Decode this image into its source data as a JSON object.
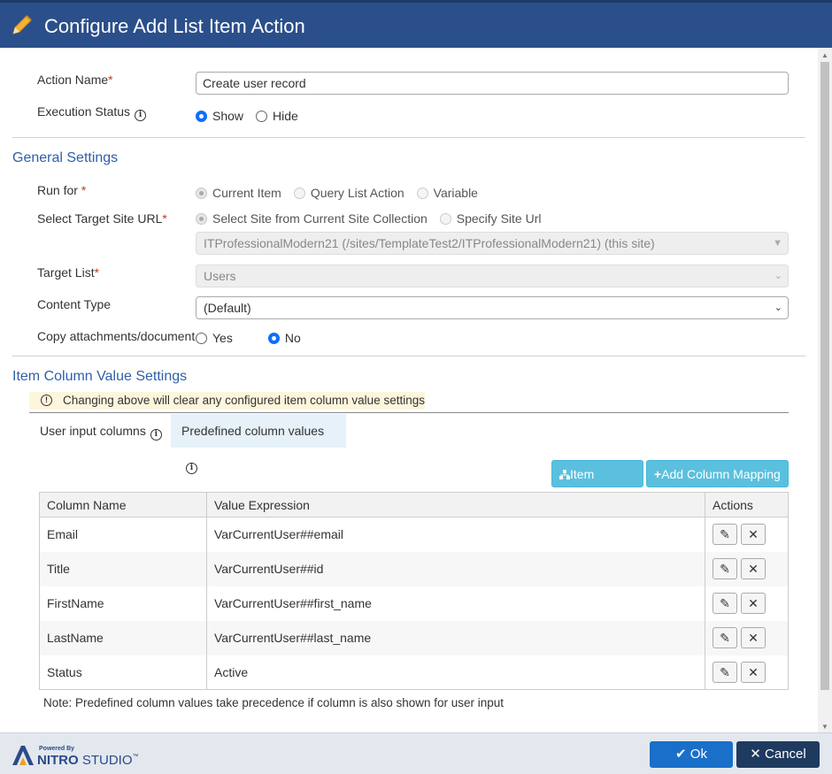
{
  "dialog": {
    "title": "Configure Add List Item Action"
  },
  "form": {
    "action_name": {
      "label": "Action Name",
      "required_mark": "*",
      "value": "Create user record"
    },
    "execution_status": {
      "label": "Execution Status",
      "options": [
        {
          "label": "Show",
          "checked": true
        },
        {
          "label": "Hide",
          "checked": false
        }
      ]
    }
  },
  "general_settings": {
    "title": "General Settings",
    "run_for": {
      "label": "Run for ",
      "required_mark": "*",
      "options": [
        "Current Item",
        "Query List Action",
        "Variable"
      ],
      "selected": "Current Item"
    },
    "target_site": {
      "label": "Select Target Site URL",
      "required_mark": "*",
      "options": [
        "Select Site from Current Site Collection",
        "Specify Site Url"
      ],
      "selected": "Select Site from Current Site Collection",
      "site_value": "ITProfessionalModern21 (/sites/TemplateTest2/ITProfessionalModern21) (this site)"
    },
    "target_list": {
      "label": "Target List",
      "required_mark": "*",
      "value": "Users"
    },
    "content_type": {
      "label": "Content Type",
      "value": "(Default)"
    },
    "copy_attachments": {
      "label": "Copy attachments/document",
      "options": [
        {
          "label": "Yes",
          "checked": false
        },
        {
          "label": "No",
          "checked": true
        }
      ]
    }
  },
  "item_columns": {
    "title": "Item Column Value Settings",
    "warning": "Changing above will clear any configured item column value settings",
    "tabs": [
      {
        "label": "User input columns",
        "active": false
      },
      {
        "label": "Predefined column values",
        "active": true
      }
    ],
    "buttons": {
      "item_actions": "Item Actions",
      "add_mapping": "Add Column Mapping"
    },
    "table": {
      "headers": [
        "Column Name",
        "Value Expression",
        "Actions"
      ],
      "rows": [
        {
          "column": "Email",
          "expression": "VarCurrentUser##email"
        },
        {
          "column": "Title",
          "expression": "VarCurrentUser##id"
        },
        {
          "column": "FirstName",
          "expression": "VarCurrentUser##first_name"
        },
        {
          "column": "LastName",
          "expression": "VarCurrentUser##last_name"
        },
        {
          "column": "Status",
          "expression": "Active"
        }
      ]
    },
    "note": "Note: Predefined column values take precedence if column is also shown for user input"
  },
  "footer": {
    "brand_powered": "Powered By",
    "brand_name_bold": "NITRO",
    "brand_name_rest": " STUDIO",
    "brand_tm": "™",
    "ok_label": "Ok",
    "cancel_label": "Cancel"
  },
  "colors": {
    "header": "#2b4f8a",
    "section_title": "#2f5fa8",
    "info_button": "#5bc0de",
    "ok_button": "#1a6fc9",
    "cancel_button": "#1e3a5f"
  }
}
